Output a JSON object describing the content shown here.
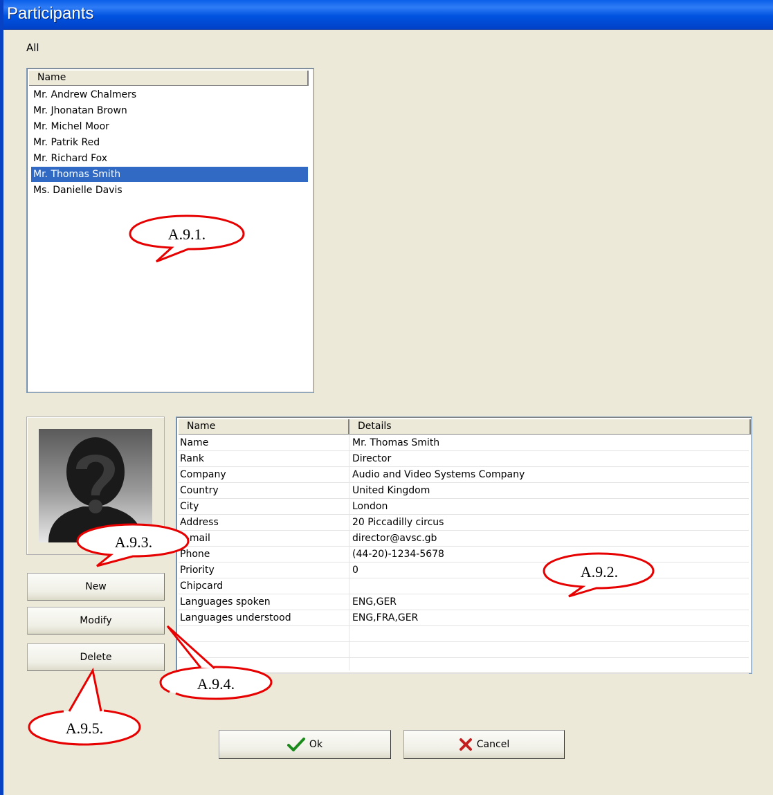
{
  "window": {
    "title": "Participants"
  },
  "filter": {
    "label": "All"
  },
  "participants": {
    "column_header": "Name",
    "items": [
      "Mr. Andrew Chalmers",
      "Mr. Jhonatan Brown",
      "Mr. Michel Moor",
      "Mr. Patrik Red",
      "Mr. Richard Fox",
      "Mr. Thomas Smith",
      "Ms. Danielle Davis"
    ],
    "selected_index": 5
  },
  "photo": {
    "icon": "unknown-person-icon"
  },
  "actions": {
    "new_label": "New",
    "modify_label": "Modify",
    "delete_label": "Delete"
  },
  "details": {
    "headers": [
      "Name",
      "Details"
    ],
    "rows": [
      {
        "name": "Name",
        "value": "Mr. Thomas Smith"
      },
      {
        "name": "Rank",
        "value": "Director"
      },
      {
        "name": "Company",
        "value": "Audio and Video Systems Company"
      },
      {
        "name": "Country",
        "value": "United Kingdom"
      },
      {
        "name": "City",
        "value": "London"
      },
      {
        "name": "Address",
        "value": "20 Piccadilly circus"
      },
      {
        "name": "E-mail",
        "value": "director@avsc.gb"
      },
      {
        "name": "Phone",
        "value": "(44-20)-1234-5678"
      },
      {
        "name": "Priority",
        "value": "0"
      },
      {
        "name": "Chipcard",
        "value": ""
      },
      {
        "name": "Languages spoken",
        "value": "ENG,GER"
      },
      {
        "name": "Languages understood",
        "value": "ENG,FRA,GER"
      }
    ]
  },
  "dialog": {
    "ok_label": "Ok",
    "cancel_label": "Cancel"
  },
  "callouts": {
    "a1": "A.9.1.",
    "a2": "A.9.2.",
    "a3": "A.9.3.",
    "a4": "A.9.4.",
    "a5": "A.9.5."
  },
  "colors": {
    "selection": "#316ac5",
    "titlebar": "#0053e0",
    "callout": "#e60000",
    "face": "#ECE9D8"
  }
}
